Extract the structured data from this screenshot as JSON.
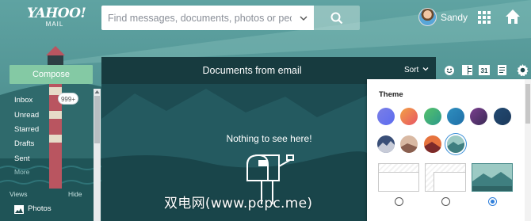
{
  "brand": {
    "logo_word": "YAHOO!",
    "logo_sub": "MAIL"
  },
  "search": {
    "placeholder": "Find messages, documents, photos or people",
    "value": ""
  },
  "user": {
    "name": "Sandy"
  },
  "compose_label": "Compose",
  "folders": [
    {
      "label": "Inbox",
      "count": "999+"
    },
    {
      "label": "Unread"
    },
    {
      "label": "Starred"
    },
    {
      "label": "Drafts"
    },
    {
      "label": "Sent"
    },
    {
      "label": "More"
    }
  ],
  "views": {
    "heading": "Views",
    "hide_label": "Hide",
    "items": [
      {
        "label": "Photos",
        "icon": "photo-icon"
      }
    ]
  },
  "main": {
    "title": "Documents from email",
    "sort_label": "Sort",
    "empty_text": "Nothing to see here!"
  },
  "toolbar_icons": [
    "emoji-icon",
    "layout-icon",
    "calendar-icon",
    "notepad-icon",
    "settings-gear-icon"
  ],
  "toolbar": {
    "calendar_day": "31"
  },
  "theme_panel": {
    "title": "Theme",
    "color_swatches": [
      {
        "name": "blue-purple",
        "from": "#7b7fe6",
        "to": "#5c6cf0"
      },
      {
        "name": "orange-pink",
        "from": "#f2a145",
        "to": "#e85565"
      },
      {
        "name": "green",
        "from": "#56c26a",
        "to": "#2b9a8a"
      },
      {
        "name": "teal-blue",
        "from": "#2f8fbf",
        "to": "#1f6fa8"
      },
      {
        "name": "purple-dark",
        "from": "#7b3f8f",
        "to": "#3a2a55"
      },
      {
        "name": "navy",
        "from": "#214a72",
        "to": "#1d3a5c"
      }
    ],
    "photo_themes": [
      "mountain-dusk",
      "desert-sky",
      "sunset-red",
      "lake-teal"
    ],
    "selected_photo_theme": "lake-teal",
    "layouts": [
      {
        "name": "layout-full",
        "selected": false
      },
      {
        "name": "layout-sidebar",
        "selected": false
      },
      {
        "name": "layout-photo",
        "selected": true
      }
    ]
  },
  "watermark_text": "双电网(www.pcpc.me)"
}
